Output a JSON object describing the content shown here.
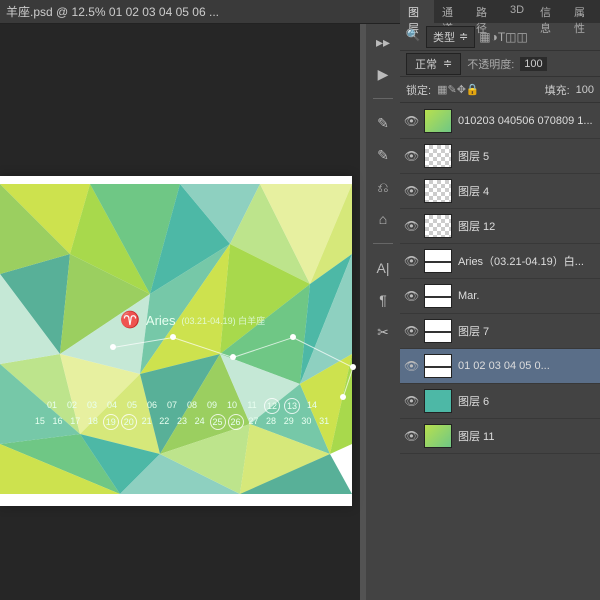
{
  "window": {
    "title": "羊座.psd @ 12.5%  01  02  03  04  05  06  ..."
  },
  "winbtns": {
    "min": "—",
    "max": "☐",
    "close": "✕"
  },
  "tools": [
    "▸▸",
    "▶",
    "✎",
    "✎",
    "⎌",
    "⌂",
    "A|",
    "¶",
    "✂"
  ],
  "panelTabs": [
    "图层",
    "通道",
    "路径",
    "3D",
    "信息",
    "属性"
  ],
  "typeRow": {
    "label": "类型",
    "dd": "⎕",
    "icons": [
      "▦",
      "◑",
      "T",
      "◫",
      "◫"
    ]
  },
  "blend": {
    "mode": "正常",
    "opLabel": "不透明度:",
    "opVal": "100"
  },
  "lock": {
    "label": "锁定:",
    "icons": [
      "▦",
      "✎",
      "✥",
      "🔒"
    ],
    "fillLabel": "填充:",
    "fillVal": "100"
  },
  "layers": [
    {
      "name": "010203 040506 070809 1...",
      "thumb": "green"
    },
    {
      "name": "图层 5",
      "thumb": "chk"
    },
    {
      "name": "图层 4",
      "thumb": "chk"
    },
    {
      "name": "图层 12",
      "thumb": "chk"
    },
    {
      "name": "Aries（03.21-04.19）白...",
      "thumb": "line"
    },
    {
      "name": "Mar.",
      "thumb": "line"
    },
    {
      "name": "图层 7",
      "thumb": "line"
    },
    {
      "name": "01  02  03  04  05  0...",
      "thumb": "line",
      "sel": true
    },
    {
      "name": "图层 6",
      "thumb": "teal"
    },
    {
      "name": "图层 11",
      "thumb": "green"
    }
  ],
  "artwork": {
    "title": "Aries",
    "subtitle": "(03.21-04.19)  白羊座",
    "rows": [
      [
        "01",
        "02",
        "03",
        "04",
        "05",
        "06",
        "07",
        "08",
        "09",
        "10",
        "11",
        "12",
        "13",
        "14"
      ],
      [
        "15",
        "16",
        "17",
        "18",
        "19",
        "20",
        "21",
        "22",
        "23",
        "24",
        "25",
        "26",
        "27",
        "28",
        "29",
        "30",
        "31"
      ]
    ],
    "circled": [
      12,
      13,
      19,
      20,
      25,
      26
    ]
  }
}
